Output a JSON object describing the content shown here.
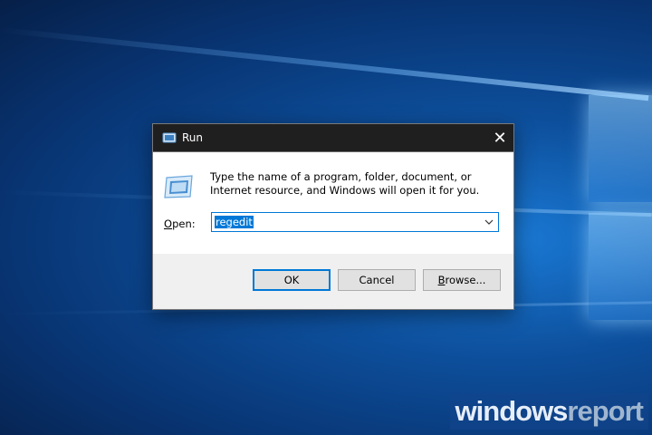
{
  "dialog": {
    "title": "Run",
    "close_glyph": "✕",
    "instruction": "Type the name of a program, folder, document, or Internet resource, and Windows will open it for you.",
    "open_label_underlined": "O",
    "open_label_rest": "pen:",
    "open_value": "regedit",
    "buttons": {
      "ok": "OK",
      "cancel": "Cancel",
      "browse_underlined": "B",
      "browse_rest": "rowse..."
    },
    "icons": {
      "title": "run-icon",
      "body": "run-icon",
      "dropdown": "chevron-down-icon",
      "close": "close-icon"
    }
  },
  "watermark": {
    "part1": "windows",
    "part2": "report"
  },
  "colors": {
    "accent": "#0078d7",
    "title_bar": "#1f1f1f",
    "dialog_bg": "#f0f0f0",
    "desktop_blue": "#0d4f9c"
  }
}
